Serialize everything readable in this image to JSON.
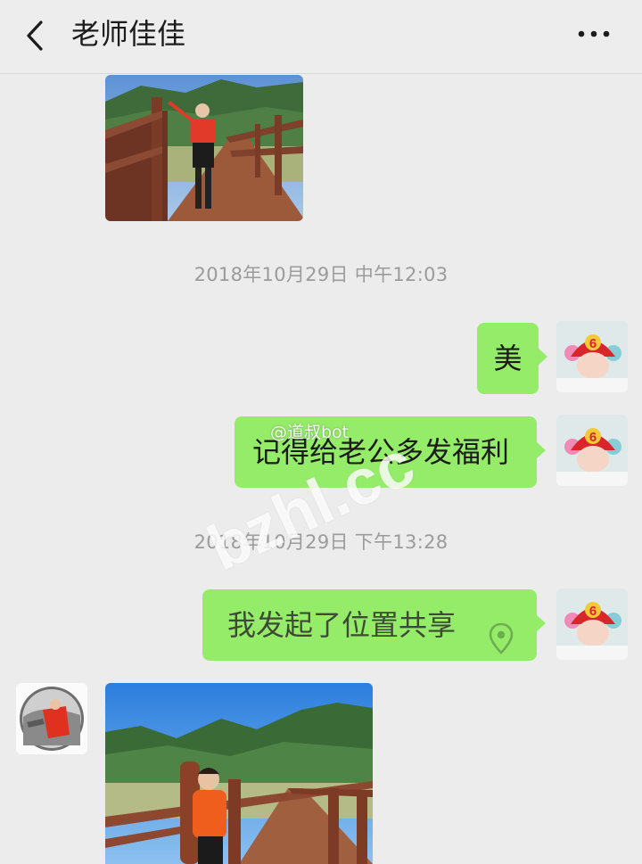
{
  "header": {
    "back_icon": "chevron-left-icon",
    "title": "老师佳佳",
    "more_icon": "more-dots-icon"
  },
  "messages": {
    "photo1": {
      "type": "image",
      "sender": "contact"
    },
    "timestamp1": "2018年10月29日 中午12:03",
    "msg1": "美",
    "msg2": "记得给老公多发福利",
    "timestamp2": "2018年10月29日 下午13:28",
    "msg3": "我发起了位置共享",
    "msg3_icon": "location-pin-icon",
    "photo2": {
      "type": "image",
      "sender": "contact"
    }
  },
  "watermark": {
    "site": "bzhl.cc",
    "weibo": "@道叔bot"
  },
  "colors": {
    "bubble_green": "#95ec69",
    "background": "#ececec",
    "timestamp_gray": "#9b9b9b"
  }
}
